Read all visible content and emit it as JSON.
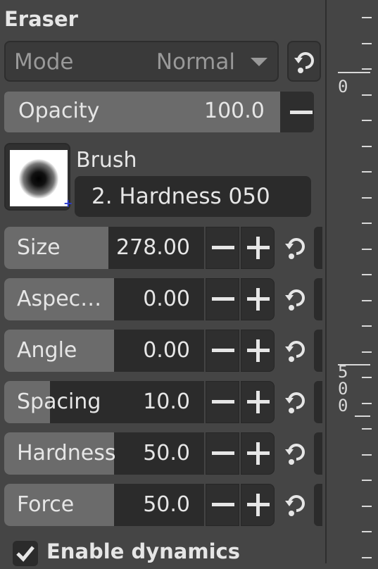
{
  "panel": {
    "title": "Eraser",
    "mode": {
      "label": "Mode",
      "value": "Normal"
    },
    "opacity": {
      "label": "Opacity",
      "value": "100.0",
      "fraction": 1.0
    },
    "brush": {
      "label": "Brush",
      "name": "2. Hardness 050"
    },
    "sliders": [
      {
        "label": "Size",
        "value": "278.00",
        "fraction": 0.52
      },
      {
        "label": "Aspec…",
        "value": "0.00",
        "fraction": 0.55
      },
      {
        "label": "Angle",
        "value": "0.00",
        "fraction": 0.55
      },
      {
        "label": "Spacing",
        "value": "10.0",
        "fraction": 0.23
      },
      {
        "label": "Hardness",
        "value": "50.0",
        "fraction": 0.55
      },
      {
        "label": "Force",
        "value": "50.0",
        "fraction": 0.55
      }
    ],
    "enable_dynamics": {
      "label": "Enable dynamics",
      "checked": true
    }
  },
  "ruler": {
    "label_top": "0",
    "label_mid_digits": [
      "5",
      "0",
      "0"
    ]
  }
}
